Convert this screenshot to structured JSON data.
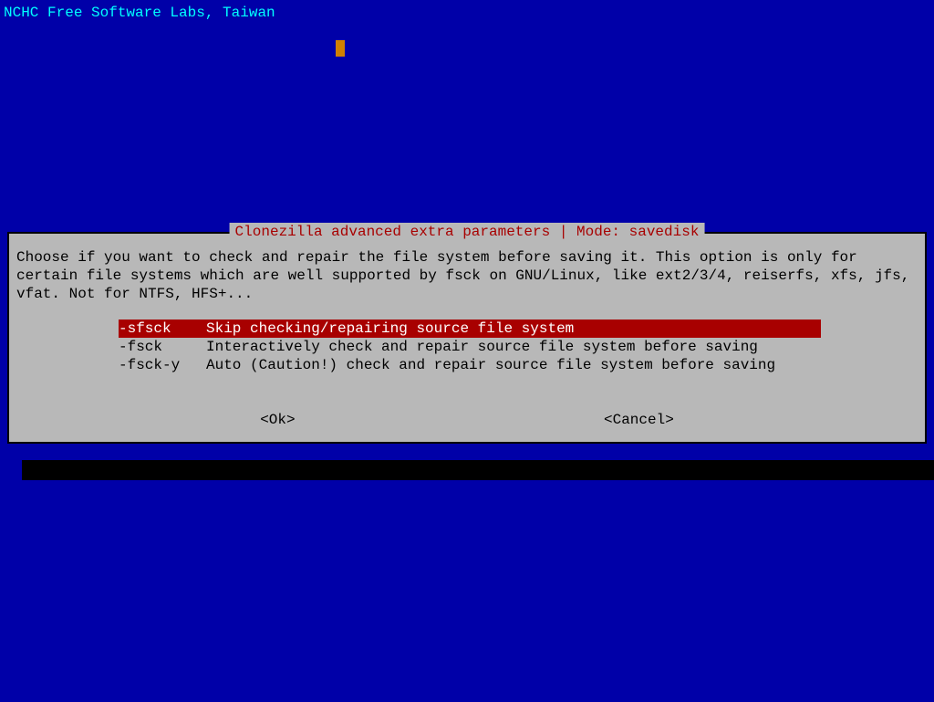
{
  "header": "NCHC Free Software Labs, Taiwan",
  "dialog": {
    "title": "Clonezilla advanced extra parameters | Mode: savedisk",
    "prompt": "Choose if you want to check and repair the file system before saving it. This option is only for certain file systems which are well supported by fsck on GNU/Linux, like ext2/3/4, reiserfs, xfs, jfs, vfat. Not for NTFS, HFS+...",
    "options": [
      {
        "flag": "-sfsck",
        "desc": "Skip checking/repairing source file system",
        "selected": true
      },
      {
        "flag": "-fsck",
        "desc": "Interactively check and repair source file system before saving",
        "selected": false
      },
      {
        "flag": "-fsck-y",
        "desc": "Auto (Caution!) check and repair source file system before saving",
        "selected": false
      }
    ],
    "buttons": {
      "ok": "<Ok>",
      "cancel": "<Cancel>"
    }
  }
}
